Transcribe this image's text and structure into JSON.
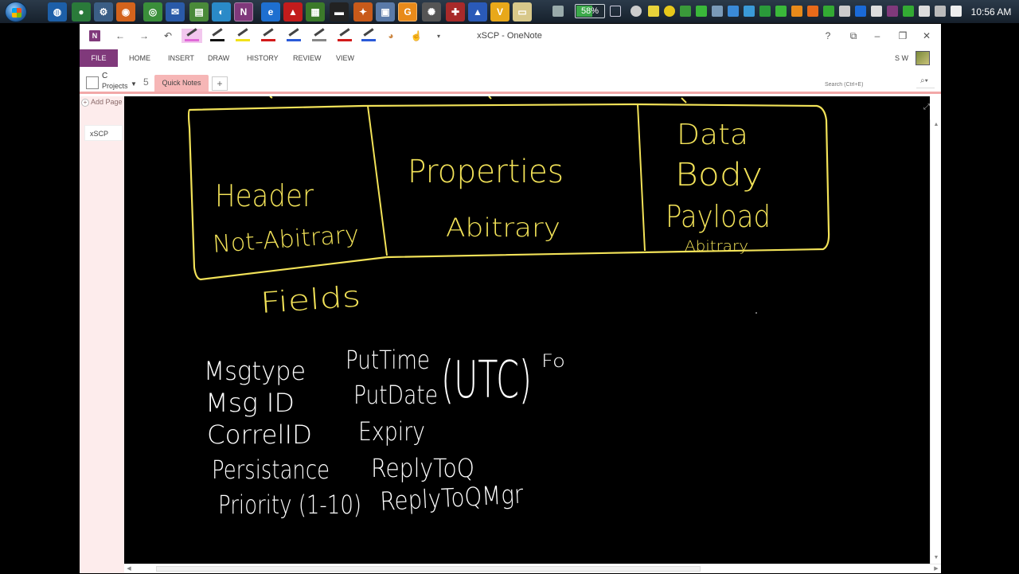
{
  "taskbar": {
    "battery_label": "58%",
    "battery_level": 0.58,
    "clock": "10:56 AM",
    "icons": [
      "globe-icon",
      "chrome-like-icon",
      "network-icon",
      "firefox-icon",
      "chrome-icon",
      "email-icon",
      "file-icon",
      "browser-icon",
      "onenote-icon",
      "ie-icon",
      "pdf-icon",
      "chart-icon",
      "terminal-icon",
      "tool-icon",
      "folder-icon",
      "g-icon",
      "settings-icon",
      "game-icon",
      "vpn-icon",
      "v-icon",
      "explorer-icon"
    ],
    "tray_icons": [
      "keyboard-icon",
      "speed-icon",
      "chat-icon",
      "shield-icon",
      "update-icon",
      "warning-icon",
      "network-tray-icon",
      "sync-icon",
      "mail-tray-icon",
      "h-icon",
      "e-icon",
      "z-icon",
      "green-icon",
      "blue-icon",
      "lock-icon",
      "onenote-tray-icon",
      "check-icon",
      "flag-icon",
      "screen-icon",
      "volume-icon"
    ]
  },
  "window": {
    "title": "xSCP - OneNote",
    "logo": "N"
  },
  "ribbon": {
    "file": "FILE",
    "tabs": [
      "HOME",
      "INSERT",
      "DRAW",
      "HISTORY",
      "REVIEW",
      "VIEW"
    ],
    "user": "S W"
  },
  "notebook": {
    "c": "C",
    "name": "Projects",
    "number": "5",
    "section": "Quick Notes",
    "add_section": "+",
    "search_placeholder": "Search (Ctrl+E)"
  },
  "pages": {
    "add_page": "Add Page",
    "items": [
      "xSCP"
    ]
  },
  "colors": {
    "onenote_purple": "#80397b",
    "section_pink": "#f6b6b6",
    "ink_yellow": "#f2e258",
    "ink_white": "#ffffff",
    "canvas_bg": "#000000"
  },
  "note": {
    "box_labels": {
      "header": "Header",
      "header_sub": "Not-Abitrary",
      "properties": "Properties",
      "properties_sub": "Abitrary",
      "data": "Data",
      "body": "Body",
      "payload": "Payload",
      "payload_sub": "Abitrary"
    },
    "fields": "Fields",
    "left_column": [
      "Msgtype",
      "Msg ID",
      "CorrelID",
      "Persistance",
      "Priority (1-10)"
    ],
    "right_column": [
      "PutTime",
      "PutDate",
      "Expiry",
      "ReplyToQ",
      "ReplyToQMgr"
    ],
    "utc": "(UTC)",
    "fo": "Fo"
  }
}
